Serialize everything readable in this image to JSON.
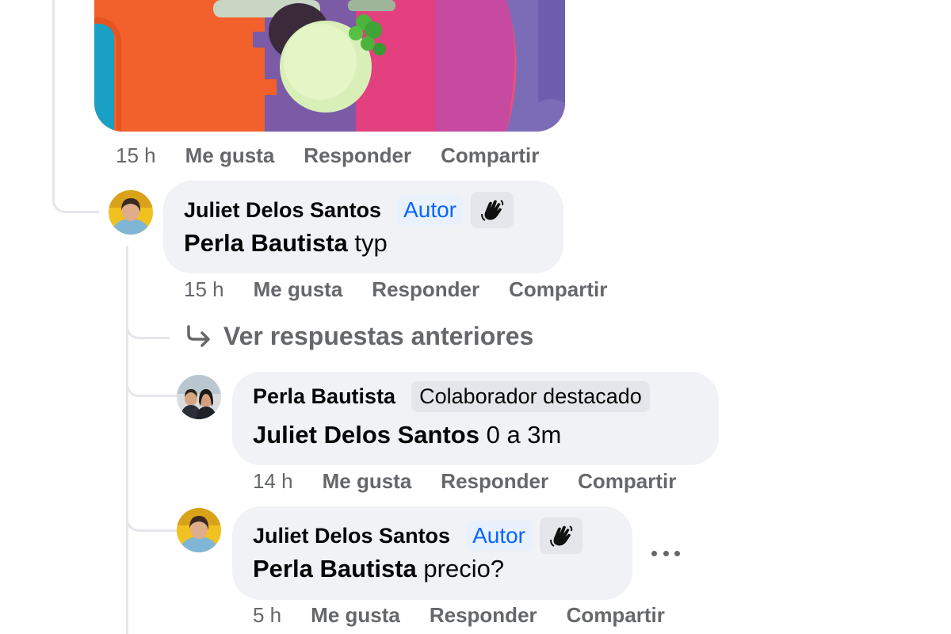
{
  "post": {
    "time": "15 h",
    "like_label": "Me gusta",
    "reply_label": "Responder",
    "share_label": "Compartir"
  },
  "comments": [
    {
      "author": "Juliet Delos Santos",
      "badge": "Autor",
      "mention": "Perla Bautista",
      "text": "typ",
      "time": "15 h",
      "like_label": "Me gusta",
      "reply_label": "Responder",
      "share_label": "Compartir"
    },
    {
      "author": "Perla Bautista",
      "badge": "Colaborador destacado",
      "mention": "Juliet Delos Santos",
      "text": "0 a 3m",
      "time": "14 h",
      "like_label": "Me gusta",
      "reply_label": "Responder",
      "share_label": "Compartir"
    },
    {
      "author": "Juliet Delos Santos",
      "badge": "Autor",
      "mention": "Perla Bautista",
      "text": "precio?",
      "time": "5 h",
      "like_label": "Me gusta",
      "reply_label": "Responder",
      "share_label": "Compartir"
    }
  ],
  "view_previous_label": "Ver respuestas anteriores",
  "icons": {
    "reply_arrow": "reply-arrow-icon",
    "wave": "waving-hand-icon",
    "more": "more-options-icon"
  },
  "colors": {
    "bubble_bg": "#f0f2f5",
    "secondary_text": "#65676b",
    "autor_blue": "#0866ff"
  }
}
